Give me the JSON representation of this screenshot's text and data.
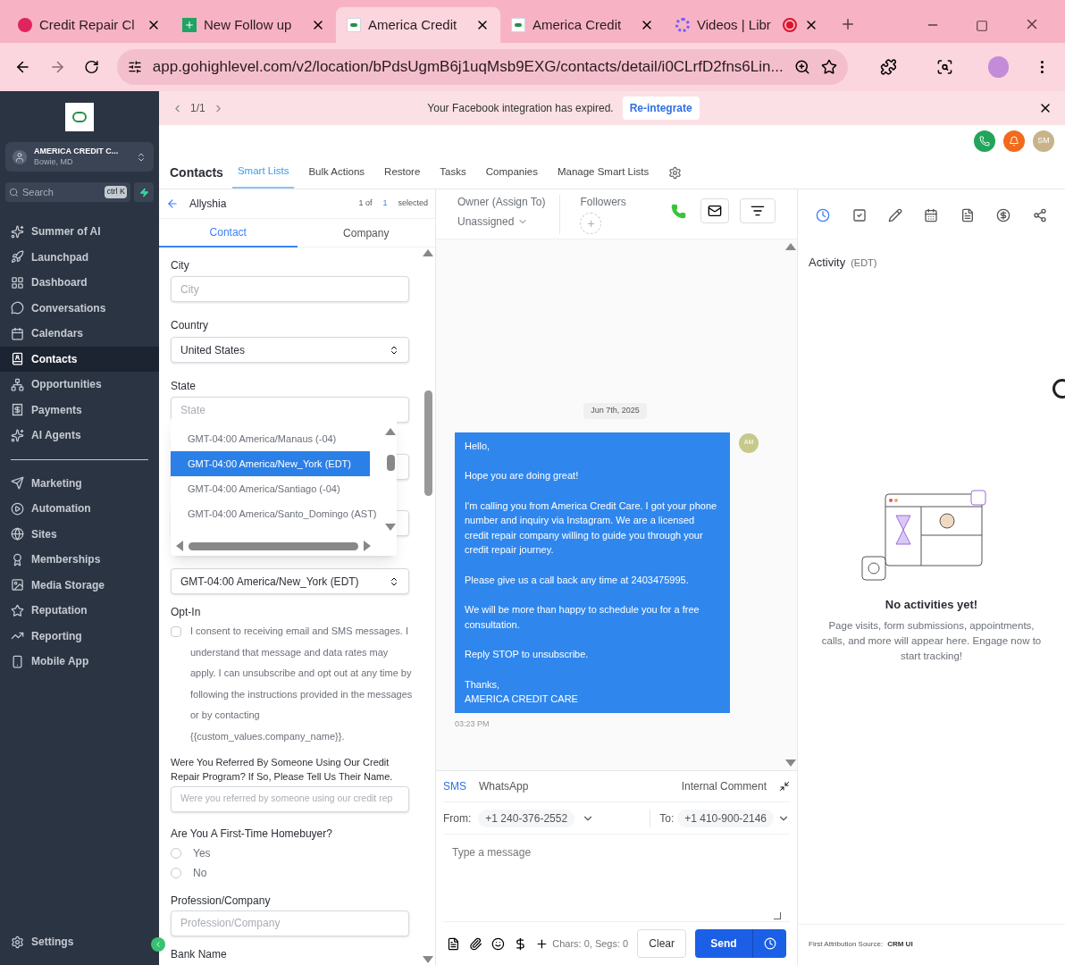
{
  "browser": {
    "tabs": [
      {
        "title": "Credit Repair Cl",
        "selected": false
      },
      {
        "title": "New Follow up",
        "selected": false
      },
      {
        "title": "America Credit",
        "selected": true
      },
      {
        "title": "America Credit",
        "selected": false
      },
      {
        "title": "Videos | Libr",
        "selected": false,
        "recording": true
      }
    ],
    "address": "app.gohighlevel.com/v2/location/bPdsUgmB6j1uqMsb9EXG/contacts/detail/i0CLrfD2fns6Lin..."
  },
  "sidebar": {
    "account": {
      "name": "AMERICA CREDIT C...",
      "location": "Bowie, MD"
    },
    "search": {
      "placeholder": "Search",
      "shortcut": "ctrl K"
    },
    "sections": [
      [
        {
          "label": "Summer of AI",
          "selected": false
        },
        {
          "label": "Launchpad",
          "selected": false
        },
        {
          "label": "Dashboard",
          "selected": false
        },
        {
          "label": "Conversations",
          "selected": false
        },
        {
          "label": "Calendars",
          "selected": false
        },
        {
          "label": "Contacts",
          "selected": true
        },
        {
          "label": "Opportunities",
          "selected": false
        },
        {
          "label": "Payments",
          "selected": false
        },
        {
          "label": "AI Agents",
          "selected": false
        }
      ],
      [
        {
          "label": "Marketing",
          "selected": false
        },
        {
          "label": "Automation",
          "selected": false
        },
        {
          "label": "Sites",
          "selected": false
        },
        {
          "label": "Memberships",
          "selected": false
        },
        {
          "label": "Media Storage",
          "selected": false
        },
        {
          "label": "Reputation",
          "selected": false
        },
        {
          "label": "Reporting",
          "selected": false
        },
        {
          "label": "Mobile App",
          "selected": false
        }
      ]
    ],
    "settings": "Settings"
  },
  "banner": {
    "pager": "1/1",
    "message": "Your Facebook integration has expired.",
    "button": "Re-integrate"
  },
  "header": {
    "avatar": "SM"
  },
  "nav": {
    "title": "Contacts",
    "tabs": [
      {
        "label": "Smart Lists",
        "selected": true
      },
      {
        "label": "Bulk Actions",
        "selected": false
      },
      {
        "label": "Restore",
        "selected": false
      },
      {
        "label": "Tasks",
        "selected": false
      },
      {
        "label": "Companies",
        "selected": false
      },
      {
        "label": "Manage Smart Lists",
        "selected": false
      }
    ]
  },
  "contact_panel": {
    "name": "Allyshia",
    "count": "1 of",
    "total": "1",
    "count_label": "selected",
    "tabs": [
      {
        "label": "Contact",
        "selected": true
      },
      {
        "label": "Company",
        "selected": false
      }
    ],
    "city": {
      "label": "City",
      "placeholder": "City"
    },
    "country": {
      "label": "Country",
      "value": "United States"
    },
    "state": {
      "label": "State",
      "placeholder": "State"
    },
    "timezone": {
      "value": "GMT-04:00 America/New_York (EDT)",
      "options": [
        {
          "label": "GMT-04:00 America/Manaus (-04)",
          "selected": false
        },
        {
          "label": "GMT-04:00 America/New_York (EDT)",
          "selected": true
        },
        {
          "label": "GMT-04:00 America/Santiago (-04)",
          "selected": false
        },
        {
          "label": "GMT-04:00 America/Santo_Domingo (AST)",
          "selected": false
        }
      ]
    },
    "opt_in": {
      "label": "Opt-In",
      "checked": false,
      "text": "I consent to receiving email and SMS messages. I understand that message and data rates may apply. I can unsubscribe and opt out at any time by following the instructions provided in the messages or by contacting {{custom_values.company_name}}."
    },
    "referral": {
      "label": "Were You Referred By Someone Using Our Credit Repair Program? If So, Please Tell Us Their Name.",
      "placeholder": "Were you referred by someone using our credit rep"
    },
    "homebuyer": {
      "label": "Are You A First-Time Homebuyer?",
      "options": [
        {
          "label": "Yes",
          "selected": false
        },
        {
          "label": "No",
          "selected": false
        }
      ]
    },
    "profession": {
      "label": "Profession/Company",
      "placeholder": "Profession/Company"
    },
    "bank": {
      "label": "Bank Name"
    }
  },
  "conversation": {
    "owner_label": "Owner (Assign To)",
    "owner": "Unassigned",
    "followers_label": "Followers",
    "date": "Jun 7th, 2025",
    "sender": "AM",
    "message": [
      "Hello,",
      "Hope you are doing great!",
      "I'm calling you from America Credit Care. I got your phone number and inquiry via Instagram. We are a licensed credit repair company willing to guide you through your credit repair journey.",
      "Please give us a call back any time at 2403475995.",
      "We will be more than happy to schedule you for a free consultation.",
      "Reply STOP to unsubscribe.",
      "Thanks,\nAMERICA CREDIT CARE"
    ],
    "time": "03:23 PM",
    "composer": {
      "channels": [
        {
          "label": "SMS",
          "selected": true
        },
        {
          "label": "WhatsApp",
          "selected": false
        }
      ],
      "internal": "Internal Comment",
      "from_label": "From:",
      "from": "+1 240-376-2552",
      "to_label": "To:",
      "to": "+1 410-900-2146",
      "placeholder": "Type a message",
      "counter": "Chars: 0, Segs: 0",
      "clear": "Clear",
      "send": "Send"
    }
  },
  "activity": {
    "tabs": [
      {
        "selected": true
      },
      {
        "selected": false
      },
      {
        "selected": false
      },
      {
        "selected": false
      },
      {
        "selected": false
      },
      {
        "selected": false
      },
      {
        "selected": false
      }
    ],
    "title": "Activity",
    "zone": "(EDT)",
    "empty_title": "No activities yet!",
    "empty_text": "Page visits, form submissions, appointments, calls, and more will appear here. Engage now to start tracking!",
    "footer_label": "First Attribution Source:",
    "footer_value": "CRM UI"
  }
}
